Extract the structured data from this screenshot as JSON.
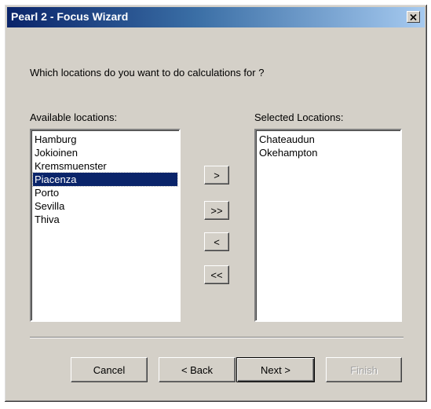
{
  "window": {
    "title": "Pearl 2 - Focus Wizard",
    "close_label": "×"
  },
  "question": "Which locations do you want to do calculations for ?",
  "available": {
    "label": "Available locations:",
    "items": [
      "Hamburg",
      "Jokioinen",
      "Kremsmuenster",
      "Piacenza",
      "Porto",
      "Sevilla",
      "Thiva"
    ],
    "selected_index": 3
  },
  "selected": {
    "label": "Selected Locations:",
    "items": [
      "Chateaudun",
      "Okehampton"
    ]
  },
  "transfer_buttons": {
    "add": ">",
    "add_all": ">>",
    "remove": "<",
    "remove_all": "<<"
  },
  "footer": {
    "cancel": "Cancel",
    "back": "< Back",
    "next": "Next >",
    "finish": "Finish"
  }
}
